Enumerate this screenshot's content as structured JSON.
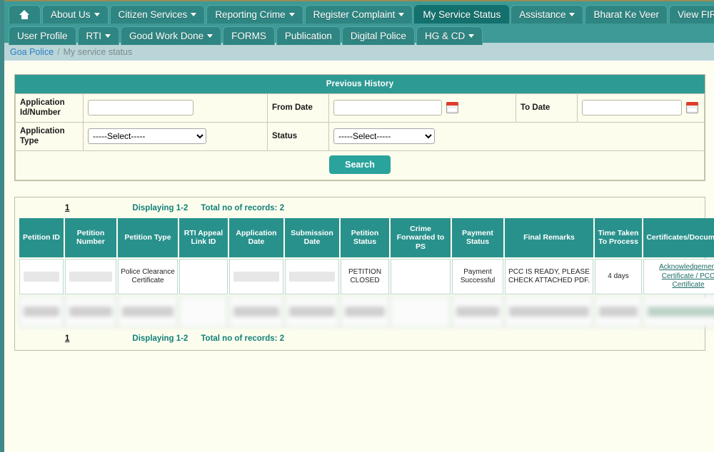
{
  "nav": {
    "row1": [
      {
        "label": "",
        "icon": "home-icon",
        "caret": false,
        "active": false,
        "name": "nav-home"
      },
      {
        "label": "About Us",
        "caret": true,
        "active": false,
        "name": "nav-about-us"
      },
      {
        "label": "Citizen Services",
        "caret": true,
        "active": false,
        "name": "nav-citizen-services"
      },
      {
        "label": "Reporting Crime",
        "caret": true,
        "active": false,
        "name": "nav-reporting-crime"
      },
      {
        "label": "Register Complaint",
        "caret": true,
        "active": false,
        "name": "nav-register-complaint"
      },
      {
        "label": "My Service Status",
        "caret": false,
        "active": true,
        "name": "nav-my-service-status"
      },
      {
        "label": "Assistance",
        "caret": true,
        "active": false,
        "name": "nav-assistance"
      },
      {
        "label": "Bharat Ke Veer",
        "caret": false,
        "active": false,
        "name": "nav-bharat-ke-veer"
      },
      {
        "label": "View FIR",
        "caret": false,
        "active": false,
        "name": "nav-view-fir"
      }
    ],
    "row2": [
      {
        "label": "User Profile",
        "caret": false,
        "name": "nav-user-profile"
      },
      {
        "label": "RTI",
        "caret": true,
        "name": "nav-rti"
      },
      {
        "label": "Good Work Done",
        "caret": true,
        "name": "nav-good-work-done"
      },
      {
        "label": "FORMS",
        "caret": false,
        "name": "nav-forms"
      },
      {
        "label": "Publication",
        "caret": false,
        "name": "nav-publication"
      },
      {
        "label": "Digital Police",
        "caret": false,
        "name": "nav-digital-police"
      },
      {
        "label": "HG & CD",
        "caret": true,
        "name": "nav-hg-cd"
      }
    ]
  },
  "breadcrumb": {
    "root": "Goa Police",
    "separator": "/",
    "current": "My service status"
  },
  "search_panel": {
    "title": "Previous History",
    "fields": {
      "application_id_label": "Application Id/Number",
      "application_id_value": "",
      "from_date_label": "From Date",
      "from_date_value": "",
      "to_date_label": "To Date",
      "to_date_value": "",
      "application_type_label": "Application Type",
      "application_type_value": "-----Select-----",
      "status_label": "Status",
      "status_value": "-----Select-----"
    },
    "select_options": [
      "-----Select-----"
    ],
    "search_button": "Search"
  },
  "results": {
    "pager_top": {
      "page_number": "1",
      "displaying": "Displaying 1-2",
      "total": "Total no of records: 2"
    },
    "pager_bottom": {
      "page_number": "1",
      "displaying": "Displaying 1-2",
      "total": "Total no of records: 2"
    },
    "columns": [
      "Petition ID",
      "Petition Number",
      "Petition Type",
      "RTI Appeal Link ID",
      "Application Date",
      "Submission Date",
      "Petition Status",
      "Crime Forwarded to PS",
      "Payment Status",
      "Final Remarks",
      "Time Taken To Process",
      "Certificates/Documents"
    ],
    "rows": [
      {
        "blurred": false,
        "cells": [
          {
            "type": "redact"
          },
          {
            "type": "redact"
          },
          {
            "type": "text",
            "value": "Police Clearance Certificate"
          },
          {
            "type": "empty"
          },
          {
            "type": "redact"
          },
          {
            "type": "redact"
          },
          {
            "type": "text",
            "value": "PETITION CLOSED"
          },
          {
            "type": "empty"
          },
          {
            "type": "text",
            "value": "Payment Successful"
          },
          {
            "type": "text",
            "value": "PCC IS READY, PLEASE CHECK ATTACHED PDF."
          },
          {
            "type": "text",
            "value": "4 days"
          },
          {
            "type": "links",
            "value": "Acknowledgement Certificate / PCC Certificate"
          }
        ]
      },
      {
        "blurred": true,
        "cells": [
          {
            "type": "redact"
          },
          {
            "type": "redact"
          },
          {
            "type": "redact"
          },
          {
            "type": "empty"
          },
          {
            "type": "redact"
          },
          {
            "type": "redact"
          },
          {
            "type": "redact"
          },
          {
            "type": "empty"
          },
          {
            "type": "redact"
          },
          {
            "type": "redact"
          },
          {
            "type": "redact"
          },
          {
            "type": "redact-green"
          }
        ]
      }
    ]
  },
  "colors": {
    "nav_bg": "#3d9a96",
    "tab": "#2e8581",
    "tab_active": "#14706c",
    "panel_header": "#2e9a94",
    "table_header": "#29918c",
    "accent_text": "#11807a",
    "link": "#2a7fc9",
    "page_bg": "#fdfdf0",
    "button": "#2aa39c"
  }
}
